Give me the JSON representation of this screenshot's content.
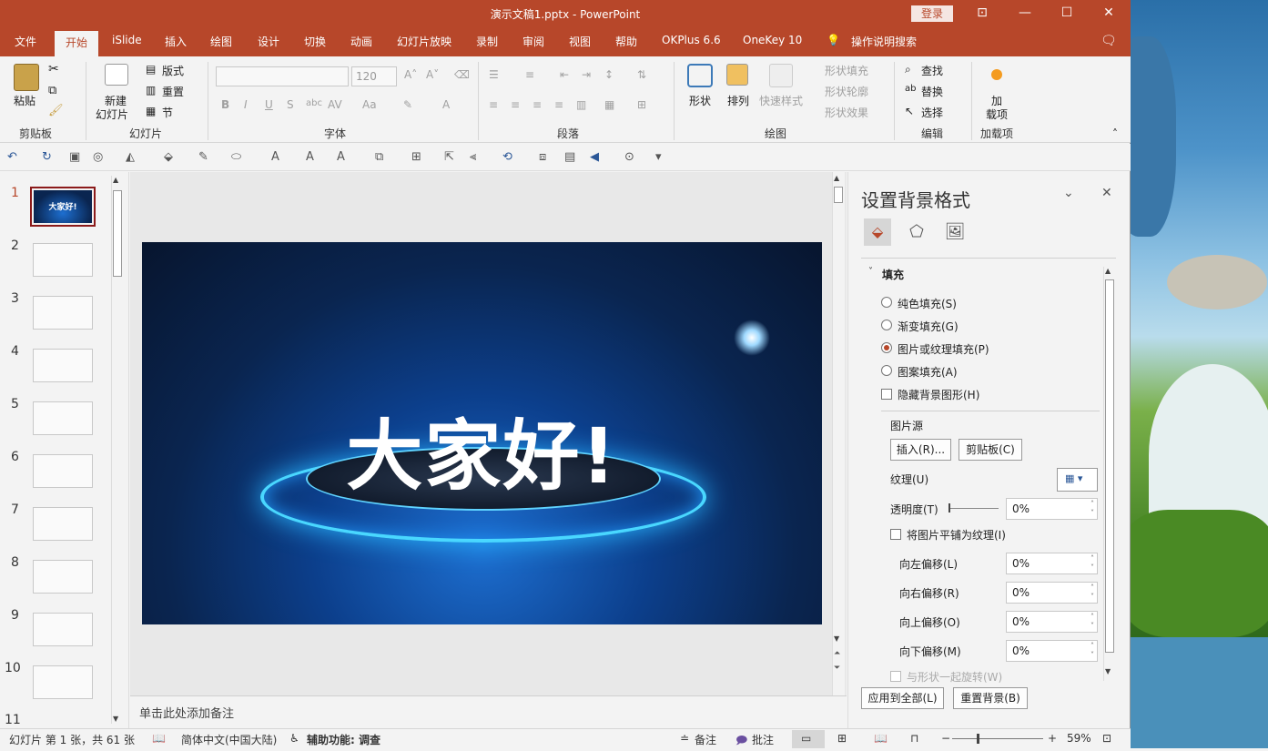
{
  "window": {
    "title": "演示文稿1.pptx  -  PowerPoint",
    "login_label": "登录",
    "controls": {
      "ribbon_display": "⊡",
      "minimize": "—",
      "maximize": "☐",
      "close": "✕"
    }
  },
  "tabs": [
    "文件",
    "开始",
    "iSlide",
    "插入",
    "绘图",
    "设计",
    "切换",
    "动画",
    "幻灯片放映",
    "录制",
    "审阅",
    "视图",
    "帮助",
    "OKPlus 6.6",
    "OneKey 10"
  ],
  "active_tab": "开始",
  "tell_me": "操作说明搜索",
  "ribbon": {
    "clipboard": {
      "label": "剪贴板",
      "paste": "粘贴"
    },
    "slides": {
      "label": "幻灯片",
      "new_slide_1": "新建",
      "new_slide_2": "幻灯片",
      "layout": "版式",
      "reset": "重置",
      "section": "节"
    },
    "font": {
      "label": "字体",
      "font_size": "120"
    },
    "paragraph": {
      "label": "段落"
    },
    "drawing": {
      "label": "绘图",
      "shapes": "形状",
      "arrange": "排列",
      "quick_styles": "快速样式",
      "shape_fill": "形状填充",
      "shape_outline": "形状轮廓",
      "shape_effects": "形状效果"
    },
    "editing": {
      "label": "编辑",
      "find": "查找",
      "replace": "替换",
      "select": "选择"
    },
    "addins": {
      "label": "加载项",
      "addins_1": "加",
      "addins_2": "载项"
    }
  },
  "thumbnails": [
    "1",
    "2",
    "3",
    "4",
    "5",
    "6",
    "7",
    "8",
    "9",
    "10",
    "11"
  ],
  "slide": {
    "text": "大家好!",
    "thumb_text": "大家好!"
  },
  "notes_placeholder": "单击此处添加备注",
  "format_pane": {
    "title": "设置背景格式",
    "section": "填充",
    "options": [
      {
        "label": "纯色填充(S)",
        "selected": false
      },
      {
        "label": "渐变填充(G)",
        "selected": false
      },
      {
        "label": "图片或纹理填充(P)",
        "selected": true
      },
      {
        "label": "图案填充(A)",
        "selected": false
      }
    ],
    "hide_bg_graphics": "隐藏背景图形(H)",
    "picture_source": "图片源",
    "insert_btn": "插入(R)...",
    "clipboard_btn": "剪贴板(C)",
    "texture": "纹理(U)",
    "transparency": "透明度(T)",
    "transparency_value": "0%",
    "tile": "将图片平铺为纹理(I)",
    "offsets": [
      {
        "label": "向左偏移(L)",
        "value": "0%"
      },
      {
        "label": "向右偏移(R)",
        "value": "0%"
      },
      {
        "label": "向上偏移(O)",
        "value": "0%"
      },
      {
        "label": "向下偏移(M)",
        "value": "0%"
      }
    ],
    "rotate_with_shape": "与形状一起旋转(W)",
    "apply_all": "应用到全部(L)",
    "reset_bg": "重置背景(B)"
  },
  "status": {
    "slide_info": "幻灯片 第 1 张，共 61 张",
    "language": "简体中文(中国大陆)",
    "accessibility": "辅助功能: 调查",
    "notes": "备注",
    "comments": "批注",
    "zoom": "59%"
  },
  "colors": {
    "accent": "#b7472a"
  }
}
